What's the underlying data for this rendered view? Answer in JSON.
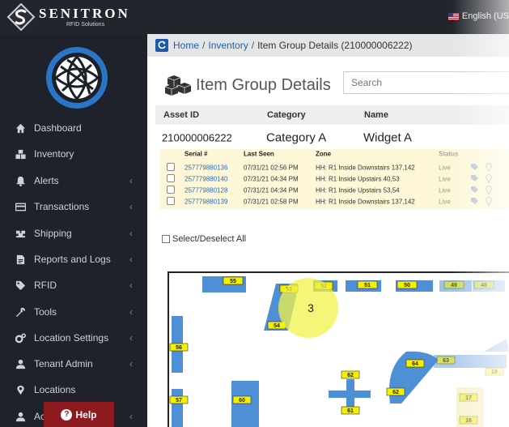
{
  "brand": {
    "name": "SENITRON",
    "subtitle": "RFID Solutions"
  },
  "language": {
    "label": "English (US"
  },
  "sidebar": {
    "items": [
      {
        "label": "Dashboard",
        "icon": "home-icon",
        "has_children": false
      },
      {
        "label": "Inventory",
        "icon": "cubes-icon",
        "has_children": false
      },
      {
        "label": "Alerts",
        "icon": "bell-icon",
        "has_children": true
      },
      {
        "label": "Transactions",
        "icon": "card-icon",
        "has_children": true
      },
      {
        "label": "Shipping",
        "icon": "shipping-icon",
        "has_children": true
      },
      {
        "label": "Reports and Logs",
        "icon": "file-icon",
        "has_children": true
      },
      {
        "label": "RFID",
        "icon": "tag-icon",
        "has_children": true
      },
      {
        "label": "Tools",
        "icon": "wrench-icon",
        "has_children": true
      },
      {
        "label": "Location Settings",
        "icon": "cogs-icon",
        "has_children": true
      },
      {
        "label": "Tenant Admin",
        "icon": "user-icon",
        "has_children": true
      },
      {
        "label": "Locations",
        "icon": "map-marker-icon",
        "has_children": false
      },
      {
        "label": "Ac",
        "icon": "user-icon",
        "has_children": true
      }
    ],
    "chevron": "‹",
    "help_label": "Help",
    "help_icon": "?"
  },
  "breadcrumb": {
    "home": "Home",
    "inventory": "Inventory",
    "current": "Item Group Details (210000006222)",
    "separator": "/"
  },
  "page": {
    "title": "Item Group Details",
    "search_placeholder": "Search"
  },
  "asset_table": {
    "headers": {
      "asset_id": "Asset ID",
      "category": "Category",
      "name": "Name"
    },
    "row": {
      "asset_id": "210000006222",
      "category": "Category A",
      "name": "Widget A"
    }
  },
  "serial_table": {
    "headers": {
      "serial": "Serial #",
      "last_seen": "Last Seen",
      "zone": "Zone",
      "status": "Status"
    },
    "rows": [
      {
        "serial": "257779880136",
        "last_seen": "07/31/21 02:56 PM",
        "zone": "HH: R1 Inside Downstairs 137,142",
        "status": "Live"
      },
      {
        "serial": "257779880140",
        "last_seen": "07/31/21 04:34 PM",
        "zone": "HH: R1 Inside Upstairs 40,53",
        "status": "Live"
      },
      {
        "serial": "257779880128",
        "last_seen": "07/31/21 04:34 PM",
        "zone": "HH: R1 Inside Upstairs 53,54",
        "status": "Live"
      },
      {
        "serial": "257779880139",
        "last_seen": "07/31/21 02:58 PM",
        "zone": "HH: R1 Inside Downstairs 137,142",
        "status": "Live"
      }
    ]
  },
  "select_all_label": "Select/Deselect All",
  "map": {
    "labels": {
      "l55": "55",
      "l53": "53",
      "l52": "52",
      "l51": "51",
      "l50": "50",
      "l49": "49",
      "l48": "48",
      "l54": "54",
      "l56": "56",
      "l57": "57",
      "l60": "60",
      "l62": "62",
      "l61": "61",
      "l64": "64",
      "l63": "63",
      "l18": "18",
      "l17": "17",
      "l16": "16"
    },
    "cluster_count": "3",
    "colors": {
      "fixture": "#4f8fd6",
      "label": "#f4f000",
      "highlight": "#f2f24a"
    }
  }
}
